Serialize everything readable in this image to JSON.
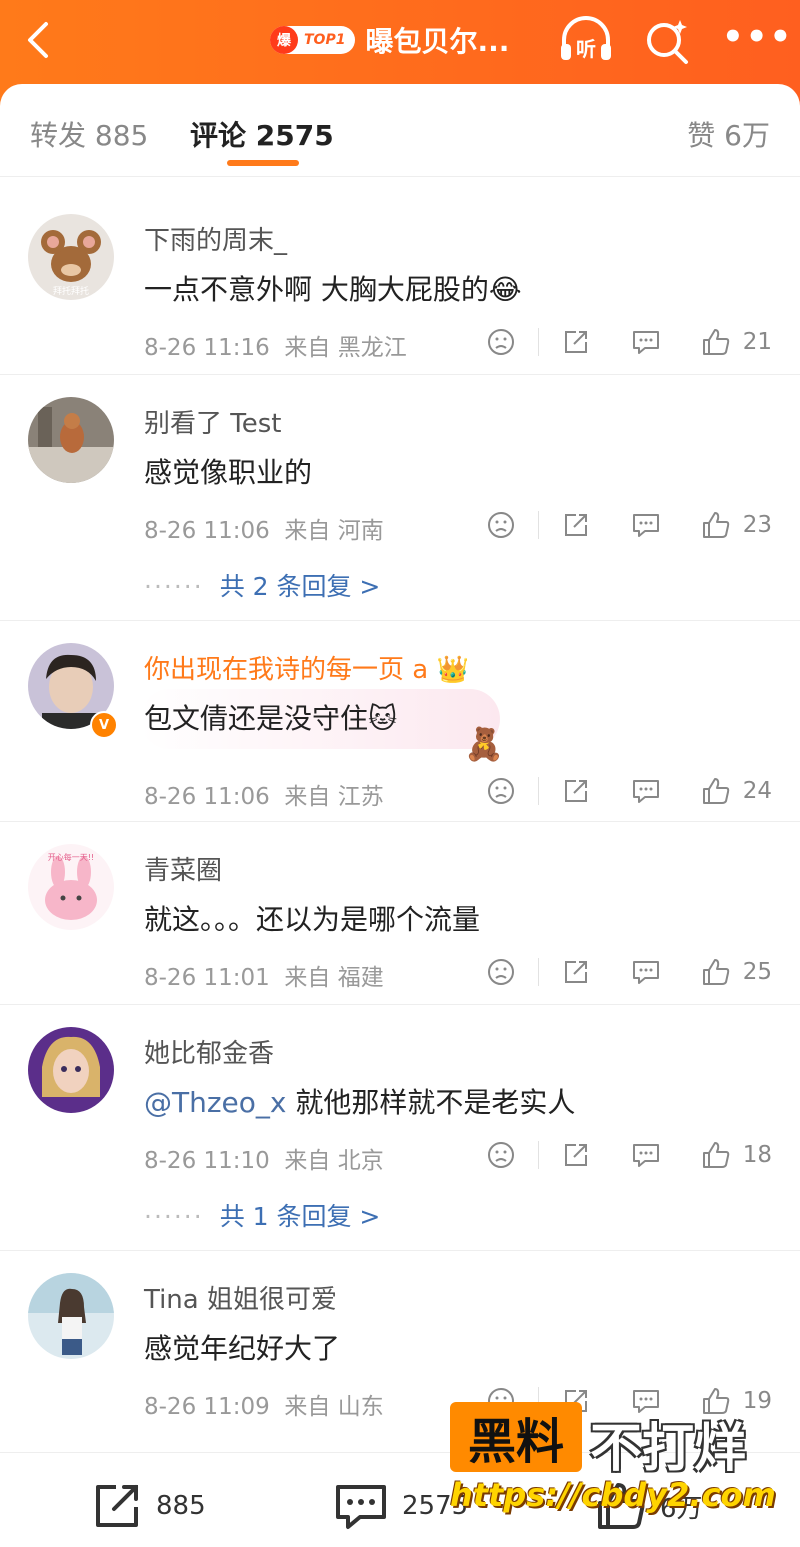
{
  "header": {
    "hot_badge_icon": "爆",
    "hot_rank": "TOP1",
    "title": "曝包贝尔...",
    "listen_label": "听"
  },
  "tabs": {
    "forward": "转发 885",
    "comments": "评论 2575",
    "likes": "赞 6万"
  },
  "comments": [
    {
      "user": "下雨的周末_",
      "text": "一点不意外啊  大胸大屁股的",
      "emoji": "😂",
      "time": "8-26 11:16",
      "from": "来自  黑龙江",
      "likes": "21",
      "avatar_label": "拜托拜托"
    },
    {
      "user": "别看了 Test",
      "text": "感觉像职业的",
      "time": "8-26 11:06",
      "from": "来自  河南",
      "likes": "23",
      "replies": "共 2 条回复 >"
    },
    {
      "user": "你出现在我诗的每一页 a",
      "text": "包文倩还是没守住",
      "time": "8-26 11:06",
      "from": "来自  江苏",
      "likes": "24",
      "verified": true
    },
    {
      "user": "青菜圈",
      "text": "就这。。。还以为是哪个流量",
      "time": "8-26 11:01",
      "from": "来自  福建",
      "likes": "25",
      "avatar_label": "开心每一天!!"
    },
    {
      "user": "她比郁金香",
      "mention": "@Thzeo_x",
      "text": " 就他那样就不是老实人",
      "time": "8-26 11:10",
      "from": "来自  北京",
      "likes": "18",
      "replies": "共 1 条回复 >"
    },
    {
      "user": "Tina 姐姐很可爱",
      "text": "感觉年纪好大了",
      "time": "8-26 11:09",
      "from": "来自  山东",
      "likes": "19"
    }
  ],
  "reply_dots": "······",
  "bottom": {
    "forward_count": "885",
    "comment_count": "2575",
    "like_count": "6万"
  },
  "watermark": {
    "box": "黑料",
    "text": "不打烊",
    "url": "https://cbdy2.com"
  },
  "colors": {
    "header_orange": "#ff6a1c",
    "link_blue": "#3d6fb3",
    "vip_orange": "#ff7a1a"
  }
}
